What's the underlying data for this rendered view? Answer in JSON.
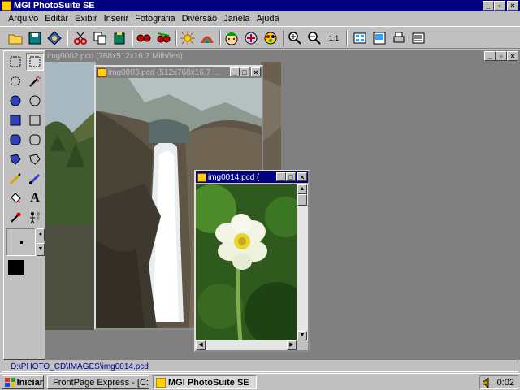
{
  "app": {
    "title": "MGI PhotoSuite SE"
  },
  "menu": [
    "Arquivo",
    "Editar",
    "Exibir",
    "Inserir",
    "Fotografia",
    "Diversão",
    "Janela",
    "Ajuda"
  ],
  "toolbar": {
    "icons": [
      "open-icon",
      "save-icon",
      "acquire-icon",
      "cut-icon",
      "copy-icon",
      "paste-icon",
      "red-eye-icon",
      "red-eye-fix-icon",
      "brightness-icon",
      "color-icon",
      "funhouse-icon",
      "effects-icon",
      "paint-effects-icon",
      "zoom-in-icon",
      "zoom-out-icon",
      "zoom-level-icon",
      "album-icon",
      "slideshow-icon",
      "print-icon",
      "web-icon"
    ],
    "zoom_label": "1:1"
  },
  "windows": {
    "max_doc_title": "img0002.pcd (768x512x16.7 Milhões)",
    "waterfall_title": "img0003.pcd (512x768x16.7 ...",
    "flower_title": "img0014.pcd ("
  },
  "status": {
    "path": "D:\\PHOTO_CD\\IMAGES\\img0014.pcd"
  },
  "taskbar": {
    "start_label": "Iniciar",
    "tasks": [
      "FrontPage Express - [C:\\M...",
      "MGI PhotoSuite SE"
    ],
    "clock": "0:02"
  },
  "colors": {
    "title_active": "#000080",
    "title_inactive": "#808080",
    "desktop_gray": "#808080",
    "face": "#c0c0c0"
  }
}
